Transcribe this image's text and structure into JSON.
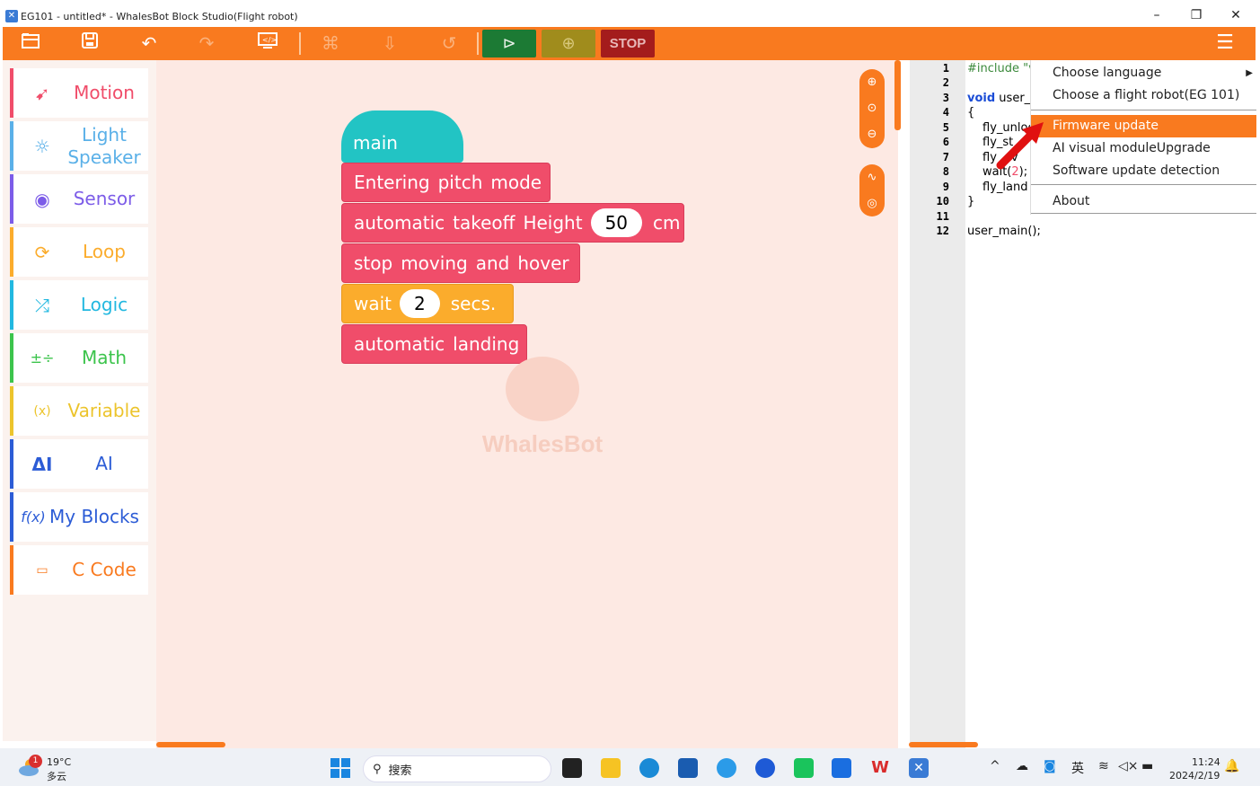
{
  "window": {
    "title": "EG101 - untitled*  - WhalesBot Block Studio(Flight robot)",
    "app_icon": "whalesbot-app-icon"
  },
  "toolbar": {
    "stop_label": "STOP",
    "colors": {
      "bar": "#f97a1f",
      "run": "#1c7a34",
      "upload": "#a08c1c",
      "stop": "#a41c1c"
    }
  },
  "categories": [
    {
      "label": "Motion",
      "icon": "drone-fly-icon",
      "color": "#f04d6a"
    },
    {
      "label": "Light Speaker",
      "icon": "sun-light-icon",
      "color": "#5ab0e8"
    },
    {
      "label": "Sensor",
      "icon": "sensor-waves-icon",
      "color": "#7c5ce8"
    },
    {
      "label": "Loop",
      "icon": "loop-arrows-icon",
      "color": "#fbac2c"
    },
    {
      "label": "Logic",
      "icon": "shuffle-icon",
      "color": "#22b8e0"
    },
    {
      "label": "Math",
      "icon": "math-operators-icon",
      "color": "#3cc44c"
    },
    {
      "label": "Variable",
      "icon": "variable-x-icon",
      "color": "#ecc42c"
    },
    {
      "label": "AI",
      "icon": "ai-icon",
      "color": "#2c5cd6"
    },
    {
      "label": "My Blocks",
      "icon": "function-icon",
      "color": "#2c5cd6",
      "icon_text": "f(x)"
    },
    {
      "label": "C Code",
      "icon": "code-monitor-icon",
      "color": "#f97a1f"
    }
  ],
  "blocks": {
    "main": "main",
    "pitch": [
      "Entering",
      "pitch",
      "mode"
    ],
    "takeoff": {
      "words": [
        "automatic",
        "takeoff",
        "Height"
      ],
      "value": "50",
      "unit": "cm"
    },
    "hover": [
      "stop",
      "moving",
      "and",
      "hover"
    ],
    "wait": {
      "label": "wait",
      "value": "2",
      "unit": "secs."
    },
    "landing": [
      "automatic",
      "landing"
    ]
  },
  "workspace": {
    "watermark": "WhalesBot"
  },
  "code": {
    "line_numbers": [
      "1",
      "2",
      "3",
      "4",
      "5",
      "6",
      "7",
      "8",
      "9",
      "10",
      "11",
      "12"
    ],
    "lines": {
      "l1": "#include \"v",
      "l3_kw": "void",
      "l3_rest": " user_",
      "l4": "{",
      "l5": "fly_unloc",
      "l6": "fly_st",
      "l7a": "fly",
      "l7b": "ov",
      "l8a": "wait(",
      "l8num": "2",
      "l8b": ");",
      "l9": "fly_land",
      "l10": "}",
      "l12": "user_main();"
    }
  },
  "menu": {
    "items": [
      {
        "label": "Choose language",
        "has_submenu": true
      },
      {
        "label": "Choose a flight robot(EG 101)"
      },
      {
        "label": "Firmware update",
        "active": true
      },
      {
        "label": "AI visual moduleUpgrade"
      },
      {
        "label": "Software update detection"
      },
      {
        "label": "About"
      }
    ]
  },
  "taskbar": {
    "weather_temp": "19°C",
    "weather_desc": "多云",
    "weather_badge": "1",
    "search_placeholder": "搜索",
    "ime": "英",
    "time": "11:24",
    "date": "2024/2/19"
  }
}
